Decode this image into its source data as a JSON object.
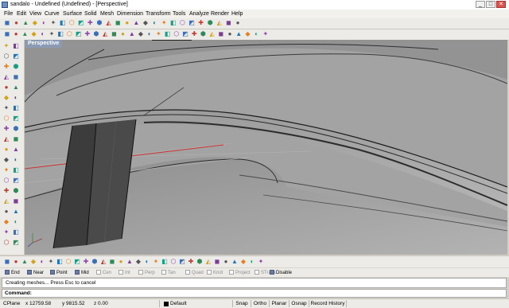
{
  "window": {
    "title": "sandalo - Undefined (Undefined) - [Perspective]",
    "controls": {
      "minimize": "_",
      "maximize": "□",
      "close": "✕"
    }
  },
  "menubar": [
    "File",
    "Edit",
    "View",
    "Curve",
    "Surface",
    "Solid",
    "Mesh",
    "Dimension",
    "Transform",
    "Tools",
    "Analyze",
    "Render",
    "Help"
  ],
  "toolbars": {
    "top_row_1": [
      "new-file-icon",
      "open-icon",
      "save-icon",
      "print-icon",
      "cut-icon",
      "copy-icon",
      "paste-icon",
      "undo-icon",
      "redo-icon",
      "pan-icon",
      "rotate-view-icon",
      "zoom-window-icon",
      "zoom-extents-icon",
      "zoom-selected-icon",
      "grid-icon",
      "four-views-icon",
      "properties-icon",
      "layer-icon",
      "object-properties-icon",
      "select-icon",
      "render-icon",
      "shade-icon",
      "rendered-view-icon",
      "material-icon",
      "light-icon",
      "help-icon"
    ],
    "top_row_2": [
      "point-icon",
      "curve-icon",
      "circle-icon",
      "rectangle-icon",
      "ellipse-icon",
      "polygon-icon",
      "arc-icon",
      "text-icon",
      "surface-icon",
      "solid-icon",
      "mesh-icon",
      "fillet-icon",
      "move-icon",
      "copy-object-icon",
      "rotate-icon",
      "scale-icon",
      "mirror-icon",
      "array-icon",
      "join-icon",
      "explode-icon",
      "trim-icon",
      "split-icon",
      "offset-icon",
      "extend-icon",
      "boolean-icon",
      "dimension-icon",
      "snap-icon",
      "color-wheel-icon",
      "analyze-icon",
      "history-icon"
    ],
    "left": [
      "select-arrow-icon",
      "point-tool-icon",
      "line-tool-icon",
      "polyline-tool-icon",
      "circle-tool-icon",
      "arc-tool-icon",
      "ellipse-tool-icon",
      "rectangle-tool-icon",
      "polygon-tool-icon",
      "curve-tool-icon",
      "freeform-icon",
      "fillet-curve-icon",
      "extrude-icon",
      "loft-icon",
      "sweep-icon",
      "revolve-icon",
      "network-icon",
      "patch-icon",
      "box-icon",
      "sphere-icon",
      "cylinder-icon",
      "cone-icon",
      "torus-icon",
      "pipe-icon",
      "boolean-union-icon",
      "boolean-diff-icon",
      "cap-icon",
      "mesh-tool-icon",
      "dim-tool-icon",
      "text-tool-icon",
      "move-tool-icon",
      "rotate-tool-icon",
      "scale-tool-icon",
      "mirror-tool-icon",
      "array-tool-icon",
      "join-tool-icon",
      "explode-tool-icon",
      "trim-tool-icon",
      "split-tool-icon",
      "group-icon"
    ],
    "bottom": [
      "set-cplane-icon",
      "cplane-origin-icon",
      "cplane-top-icon",
      "cplane-front-icon",
      "cplane-right-icon",
      "cplane-perp-icon",
      "cplane-3pt-icon",
      "cplane-object-icon",
      "cplane-view-icon",
      "cplane-elevation-icon",
      "cplane-rotate-icon",
      "cplane-world-icon",
      "named-cplane-icon",
      "grid-settings-icon",
      "ortho-icon",
      "planar-icon",
      "osnap-icon",
      "history-icon",
      "layer-panel-icon",
      "color-panel-icon",
      "linetype-icon",
      "print-width-icon",
      "render-mesh-icon",
      "mesh-settings-icon",
      "curvature-icon",
      "zebra-icon",
      "environment-icon",
      "draft-angle-icon",
      "emap-icon",
      "edge-analysis-icon"
    ]
  },
  "viewport": {
    "label": "Perspective"
  },
  "osnaps": [
    {
      "label": "End",
      "checked": true
    },
    {
      "label": "Near",
      "checked": true
    },
    {
      "label": "Point",
      "checked": true
    },
    {
      "label": "Mid",
      "checked": true
    },
    {
      "label": "Cen",
      "checked": false
    },
    {
      "label": "Int",
      "checked": false
    },
    {
      "label": "Perp",
      "checked": false
    },
    {
      "label": "Tan",
      "checked": false
    },
    {
      "label": "Quad",
      "checked": false
    },
    {
      "label": "Knot",
      "checked": false
    },
    {
      "label": "Project",
      "checked": false
    },
    {
      "label": "STrack",
      "checked": false
    },
    {
      "label": "Disable",
      "checked": true
    }
  ],
  "command_history": "Creating meshes... Press Esc to cancel",
  "command": {
    "label": "Command:",
    "value": ""
  },
  "status": {
    "cplane": "CPlane",
    "x": "x 12759.58",
    "y": "y 9815.52",
    "z": "z 0.00",
    "layer": "Default",
    "snap": "Snap",
    "ortho": "Ortho",
    "planar": "Planar",
    "osnap": "Osnap",
    "history": "Record History"
  },
  "colors": {
    "viewport_bg": "#a7a7a7",
    "viewport_tab": "#8c9bb4",
    "osnap_on": "#6c7ca0"
  }
}
